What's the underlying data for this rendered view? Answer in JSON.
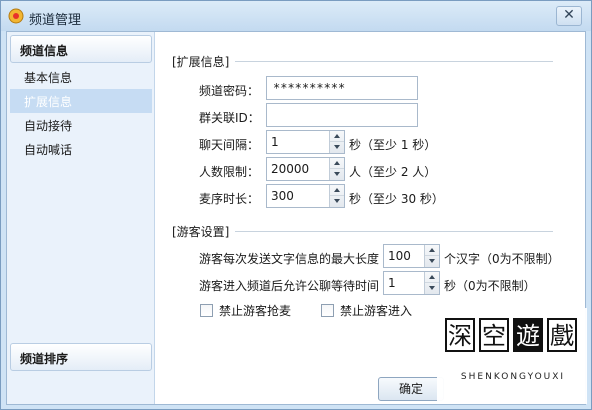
{
  "window": {
    "title": "频道管理",
    "close_glyph": "✕"
  },
  "sidebar": {
    "group_top": "频道信息",
    "items": [
      {
        "label": "基本信息"
      },
      {
        "label": "扩展信息"
      },
      {
        "label": "自动接待"
      },
      {
        "label": "自动喊话"
      }
    ],
    "group_bottom": "频道排序"
  },
  "extended": {
    "section_title": "[扩展信息]",
    "password_label": "频道密码：",
    "password_value": "**********",
    "group_id_label": "群关联ID：",
    "group_id_value": "",
    "chat_interval_label": "聊天间隔：",
    "chat_interval_value": "1",
    "chat_interval_unit": "秒（至少 1 秒）",
    "user_limit_label": "人数限制：",
    "user_limit_value": "20000",
    "user_limit_unit": "人（至少 2 人）",
    "mic_time_label": "麦序时长：",
    "mic_time_value": "300",
    "mic_time_unit": "秒（至少 30 秒）"
  },
  "guest": {
    "section_title": "[游客设置]",
    "max_text_label": "游客每次发送文字信息的最大长度",
    "max_text_value": "100",
    "max_text_unit": "个汉字（0为不限制）",
    "wait_label": "游客进入频道后允许公聊等待时间",
    "wait_value": "1",
    "wait_unit": "秒（0为不限制）",
    "no_grab_mic_label": "禁止游客抢麦",
    "no_grab_mic_checked": false,
    "no_enter_label": "禁止游客进入",
    "no_enter_checked": false
  },
  "footer": {
    "ok_label": "确定"
  },
  "watermark": {
    "chars": [
      "深",
      "空",
      "遊",
      "戲"
    ],
    "subtitle": "SHENKONGYOUXI"
  }
}
